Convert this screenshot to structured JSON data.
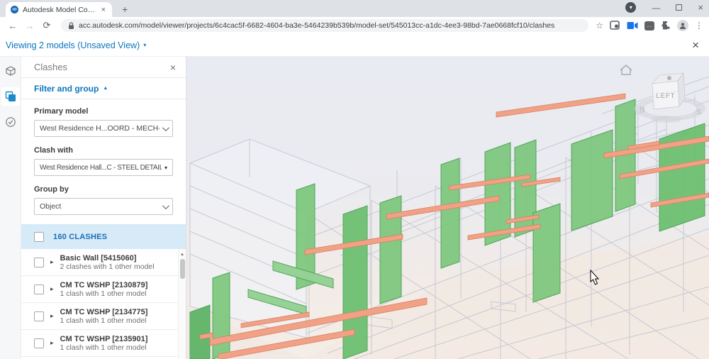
{
  "browser": {
    "tab_title": "Autodesk Model Coordination",
    "tab_close": "×",
    "new_tab": "+",
    "record_caret": "▾",
    "minimize": "—",
    "window_close": "×",
    "back": "←",
    "forward": "→",
    "reload": "⟳",
    "url": "acc.autodesk.com/model/viewer/projects/6c4cac5f-6682-4604-ba3e-5464239b539b/model-set/545013cc-a1dc-4ee3-98bd-7ae0668fcf10/clashes",
    "bookmark_star": "☆",
    "extension_dots": "...",
    "menu_dots": "⋮"
  },
  "header": {
    "viewing": "Viewing 2 models (Unsaved View)",
    "caret": "▾",
    "close": "×"
  },
  "clashes_panel": {
    "title": "Clashes",
    "close": "×",
    "filter_toggle": "Filter and group",
    "filter_caret": "▲",
    "primary_model_label": "Primary model",
    "primary_model_value": "West Residence H...OORD - MECH-DUCT",
    "clash_with_label": "Clash with",
    "clash_with_value": "West Residence Hall...C - STEEL DETAILING",
    "clash_with_caret": "▾",
    "group_by_label": "Group by",
    "group_by_value": "Object",
    "count_label": "160 CLASHES",
    "item_caret": "▸",
    "scroll_up_arrow": "▴",
    "items": [
      {
        "title": "Basic Wall [5415060]",
        "subtitle": "2 clashes with 1 other model"
      },
      {
        "title": "CM TC WSHP [2130879]",
        "subtitle": "1 clash with 1 other model"
      },
      {
        "title": "CM TC WSHP [2134775]",
        "subtitle": "1 clash with 1 other model"
      },
      {
        "title": "CM TC WSHP [2135901]",
        "subtitle": "1 clash with 1 other model"
      }
    ]
  },
  "viewport": {
    "viewcube_face": "LEFT",
    "compass_north": "N",
    "compass_south": "S"
  },
  "colors": {
    "accent_blue": "#0b76c0",
    "count_row_bg": "#d6eaf8",
    "clash_green": "#7cc77c",
    "clash_orange": "#f0a186"
  }
}
